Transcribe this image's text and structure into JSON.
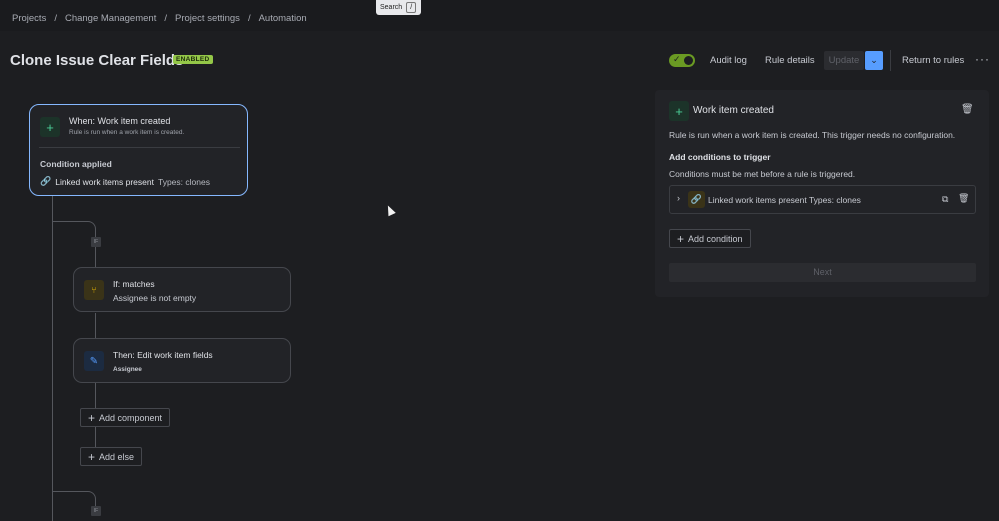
{
  "breadcrumb": [
    "Projects",
    "Change Management",
    "Project settings",
    "Automation"
  ],
  "search": {
    "label": "Search",
    "shortcut": "/"
  },
  "rule": {
    "title": "Clone Issue Clear Fields",
    "status": "ENABLED"
  },
  "header": {
    "audit_log": "Audit log",
    "rule_details": "Rule details",
    "update": "Update",
    "return": "Return to rules",
    "more": "···"
  },
  "trigger": {
    "title": "When: Work item created",
    "subtitle": "Rule is run when a work item is created.",
    "condition_label": "Condition applied",
    "condition_name": "Linked work items present",
    "condition_detail": "Types: clones"
  },
  "branch_tag": "IF",
  "if_node": {
    "title": "If: matches",
    "subtitle": "Assignee is not empty"
  },
  "then_node": {
    "title": "Then: Edit work item fields",
    "subtitle": "Assignee"
  },
  "buttons": {
    "add_component": "Add component",
    "add_else": "Add else"
  },
  "panel": {
    "title": "Work item created",
    "description": "Rule is run when a work item is created. This trigger needs no configuration.",
    "heading": "Add conditions to trigger",
    "note": "Conditions must be met before a rule is triggered.",
    "condition": "Linked work items present Types: clones",
    "add_condition": "Add condition",
    "next": "Next"
  },
  "colors": {
    "accent": "#579dff",
    "enabled": "#94c748",
    "selected_border": "#85b8ff"
  },
  "icons": [
    "plus-icon",
    "link-icon",
    "branch-icon",
    "edit-icon",
    "trash-icon",
    "copy-icon",
    "chevron-right-icon",
    "chevron-down-icon"
  ]
}
